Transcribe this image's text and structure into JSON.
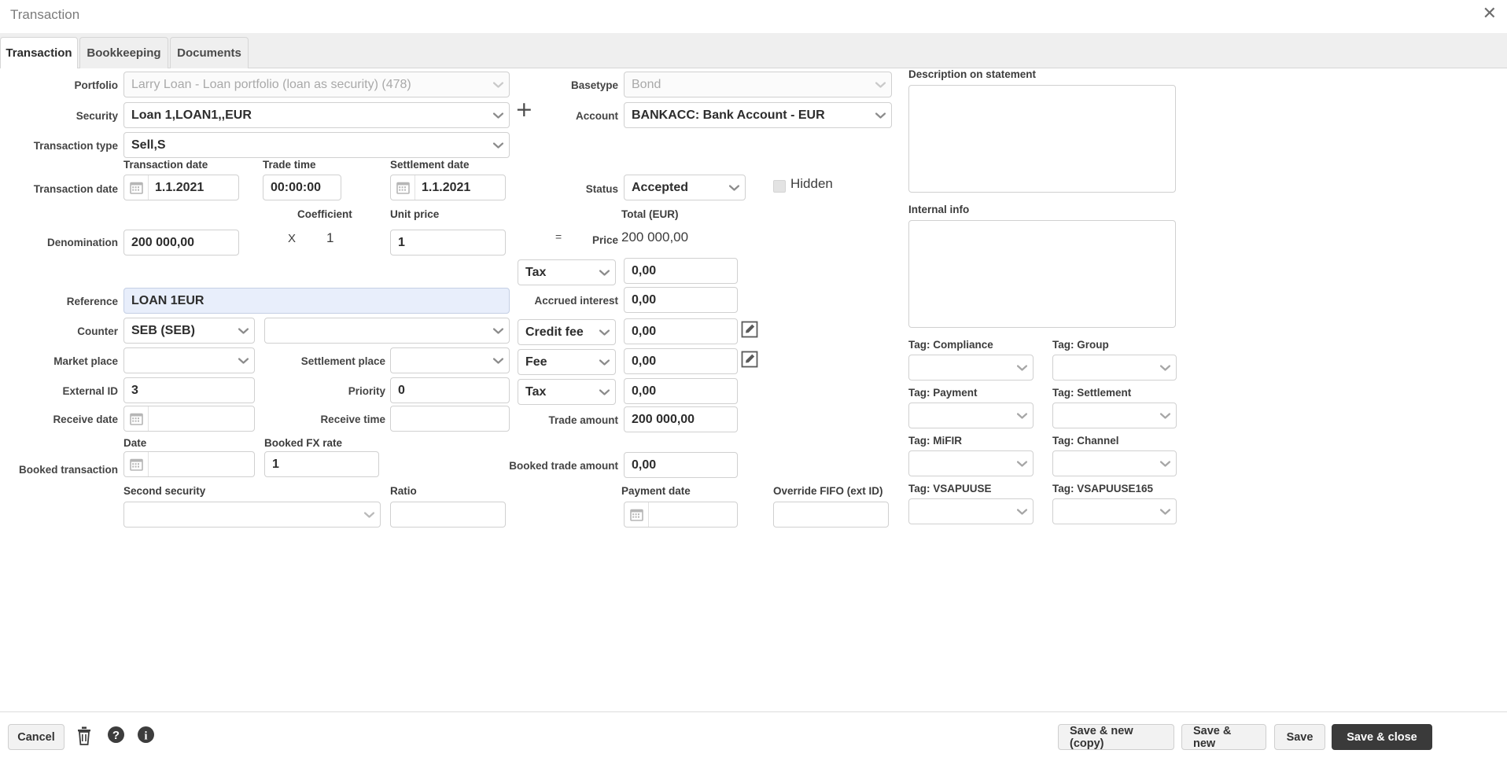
{
  "window": {
    "title": "Transaction",
    "close_icon": "close-icon",
    "close_glyph": "✕"
  },
  "tabs": [
    {
      "label": "Transaction",
      "active": true
    },
    {
      "label": "Bookkeeping",
      "active": false
    },
    {
      "label": "Documents",
      "active": false
    }
  ],
  "left": {
    "portfolio_label": "Portfolio",
    "portfolio_value": "Larry Loan - Loan portfolio (loan as security) (478)",
    "security_label": "Security",
    "security_value": "Loan 1,LOAN1,,EUR",
    "add_security_glyph": "+",
    "transaction_type_label": "Transaction type",
    "transaction_type_value": "Sell,S",
    "transaction_date_label": "Transaction date",
    "transaction_date_header": "Transaction date",
    "transaction_date_value": "1.1.2021",
    "trade_time_header": "Trade time",
    "trade_time_value": "00:00:00",
    "settlement_date_header": "Settlement date",
    "settlement_date_value": "1.1.2021",
    "coefficient_header": "Coefficient",
    "coefficient_value": "1",
    "unit_price_header": "Unit price",
    "unit_price_value": "1",
    "denomination_label": "Denomination",
    "denomination_value": "200 000,00",
    "multiply_glyph": "X",
    "reference_label": "Reference",
    "reference_value": "LOAN 1EUR",
    "counter_label": "Counter",
    "counter_value": "SEB (SEB)",
    "counter_second_value": "",
    "market_place_label": "Market place",
    "market_place_value": "",
    "settlement_place_label": "Settlement place",
    "settlement_place_value": "",
    "external_id_label": "External ID",
    "external_id_value": "3",
    "priority_label": "Priority",
    "priority_value": "0",
    "receive_date_label": "Receive date",
    "receive_date_value": "",
    "receive_time_label": "Receive time",
    "receive_time_value": "",
    "booked_transaction_label": "Booked transaction",
    "booked_date_header": "Date",
    "booked_date_value": "",
    "booked_fx_rate_header": "Booked FX rate",
    "booked_fx_rate_value": "1",
    "second_security_header": "Second security",
    "second_security_value": "",
    "ratio_header": "Ratio",
    "ratio_value": ""
  },
  "middle": {
    "basetype_label": "Basetype",
    "basetype_value": "Bond",
    "account_label": "Account",
    "account_value": "BANKACC: Bank Account - EUR",
    "status_label": "Status",
    "status_value": "Accepted",
    "hidden_label": "Hidden",
    "hidden_checked": false,
    "total_header": "Total (EUR)",
    "equals_glyph": "=",
    "price_label": "Price",
    "price_value": "200 000,00",
    "tax1_select": "Tax",
    "tax1_value": "0,00",
    "accrued_interest_label": "Accrued interest",
    "accrued_interest_value": "0,00",
    "credit_fee_select": "Credit fee",
    "credit_fee_value": "0,00",
    "fee_select": "Fee",
    "fee_value": "0,00",
    "tax2_select": "Tax",
    "tax2_value": "0,00",
    "trade_amount_label": "Trade amount",
    "trade_amount_value": "200 000,00",
    "booked_trade_amount_label": "Booked trade amount",
    "booked_trade_amount_value": "0,00",
    "payment_date_header": "Payment date",
    "payment_date_value": "",
    "override_fifo_header": "Override FIFO (ext ID)",
    "override_fifo_value": ""
  },
  "right": {
    "description_label": "Description on statement",
    "description_value": "",
    "internal_info_label": "Internal info",
    "internal_info_value": "",
    "tags": [
      {
        "label": "Tag: Compliance",
        "value": ""
      },
      {
        "label": "Tag: Group",
        "value": ""
      },
      {
        "label": "Tag: Payment",
        "value": ""
      },
      {
        "label": "Tag: Settlement",
        "value": ""
      },
      {
        "label": "Tag: MiFIR",
        "value": ""
      },
      {
        "label": "Tag: Channel",
        "value": ""
      },
      {
        "label": "Tag: VSAPUUSE",
        "value": ""
      },
      {
        "label": "Tag: VSAPUUSE165",
        "value": ""
      }
    ]
  },
  "footer": {
    "cancel_label": "Cancel",
    "delete_icon": "trash-icon",
    "help_icon": "help-icon",
    "info_icon": "info-icon",
    "save_new_copy_label": "Save & new (copy)",
    "save_new_label": "Save & new",
    "save_label": "Save",
    "save_close_label": "Save & close"
  },
  "colors": {
    "accent_dark": "#3a3a3a",
    "focus_field": "#e8eefb",
    "tab_strip": "#efefef",
    "border": "#d0d0d0"
  }
}
